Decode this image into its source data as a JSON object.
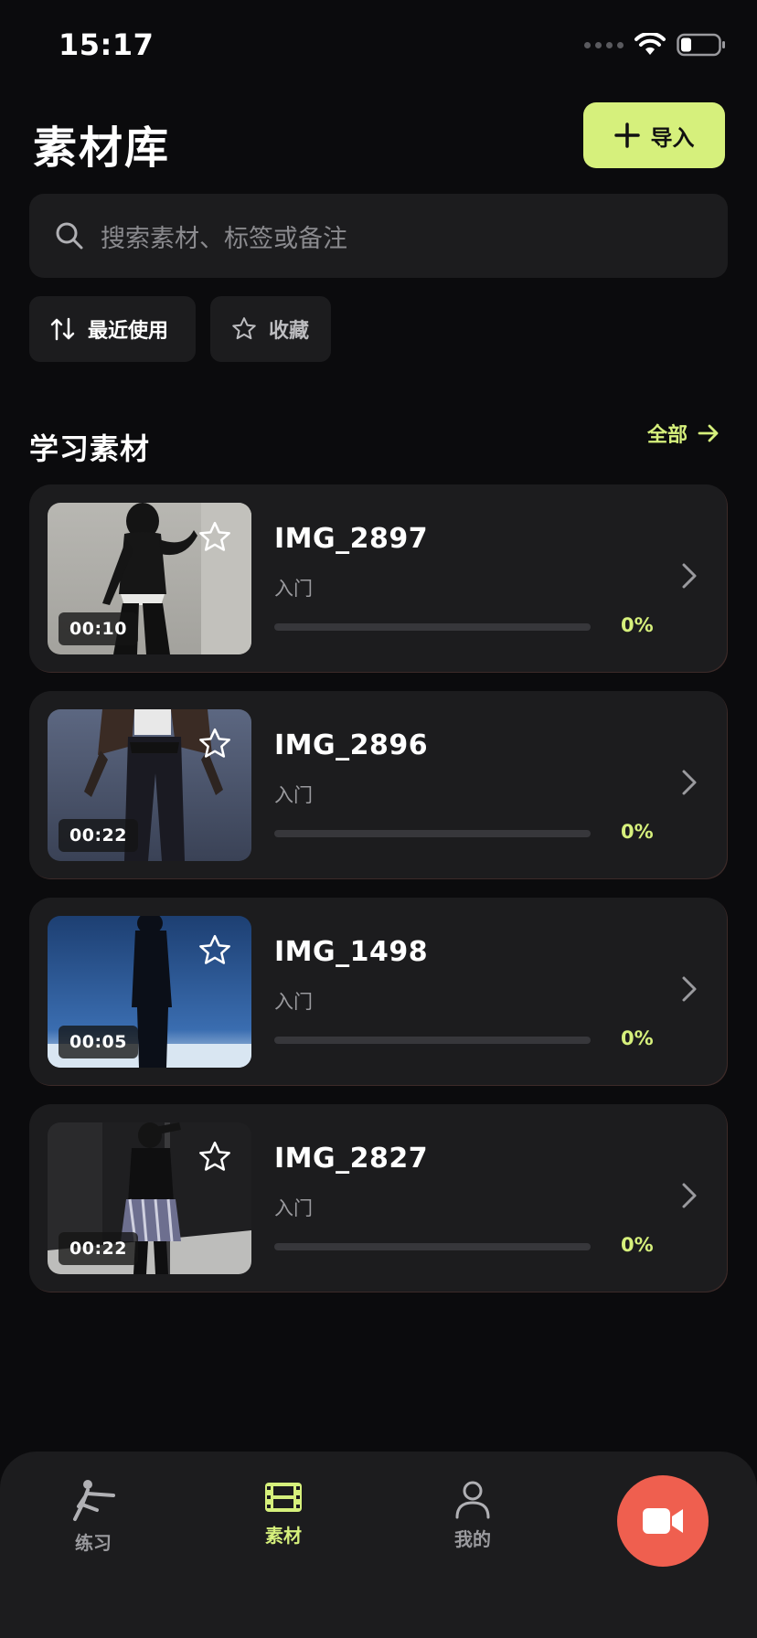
{
  "status_bar": {
    "time": "15:17"
  },
  "header": {
    "title": "素材库",
    "import_label": "导入"
  },
  "search": {
    "placeholder": "搜索素材、标签或备注"
  },
  "filters": [
    {
      "label": "最近使用",
      "icon": "sort-icon"
    },
    {
      "label": "收藏",
      "icon": "star-icon"
    }
  ],
  "section": {
    "title": "学习素材",
    "view_all_label": "全部"
  },
  "materials": [
    {
      "title": "IMG_2897",
      "level": "入门",
      "duration": "00:10",
      "progress_label": "0%",
      "progress": 0,
      "favorited": false
    },
    {
      "title": "IMG_2896",
      "level": "入门",
      "duration": "00:22",
      "progress_label": "0%",
      "progress": 0,
      "favorited": false
    },
    {
      "title": "IMG_1498",
      "level": "入门",
      "duration": "00:05",
      "progress_label": "0%",
      "progress": 0,
      "favorited": false
    },
    {
      "title": "IMG_2827",
      "level": "入门",
      "duration": "00:22",
      "progress_label": "0%",
      "progress": 0,
      "favorited": false
    }
  ],
  "tab_bar": {
    "tabs": [
      {
        "label": "练习",
        "icon": "dance-figure-icon",
        "active": false
      },
      {
        "label": "素材",
        "icon": "film-strip-icon",
        "active": true
      },
      {
        "label": "我的",
        "icon": "person-icon",
        "active": false
      }
    ],
    "record_icon": "video-camera-icon"
  },
  "colors": {
    "accent": "#d6f07c",
    "record": "#ef5f4f",
    "background": "#0b0b0d",
    "surface": "#1c1c1e"
  }
}
